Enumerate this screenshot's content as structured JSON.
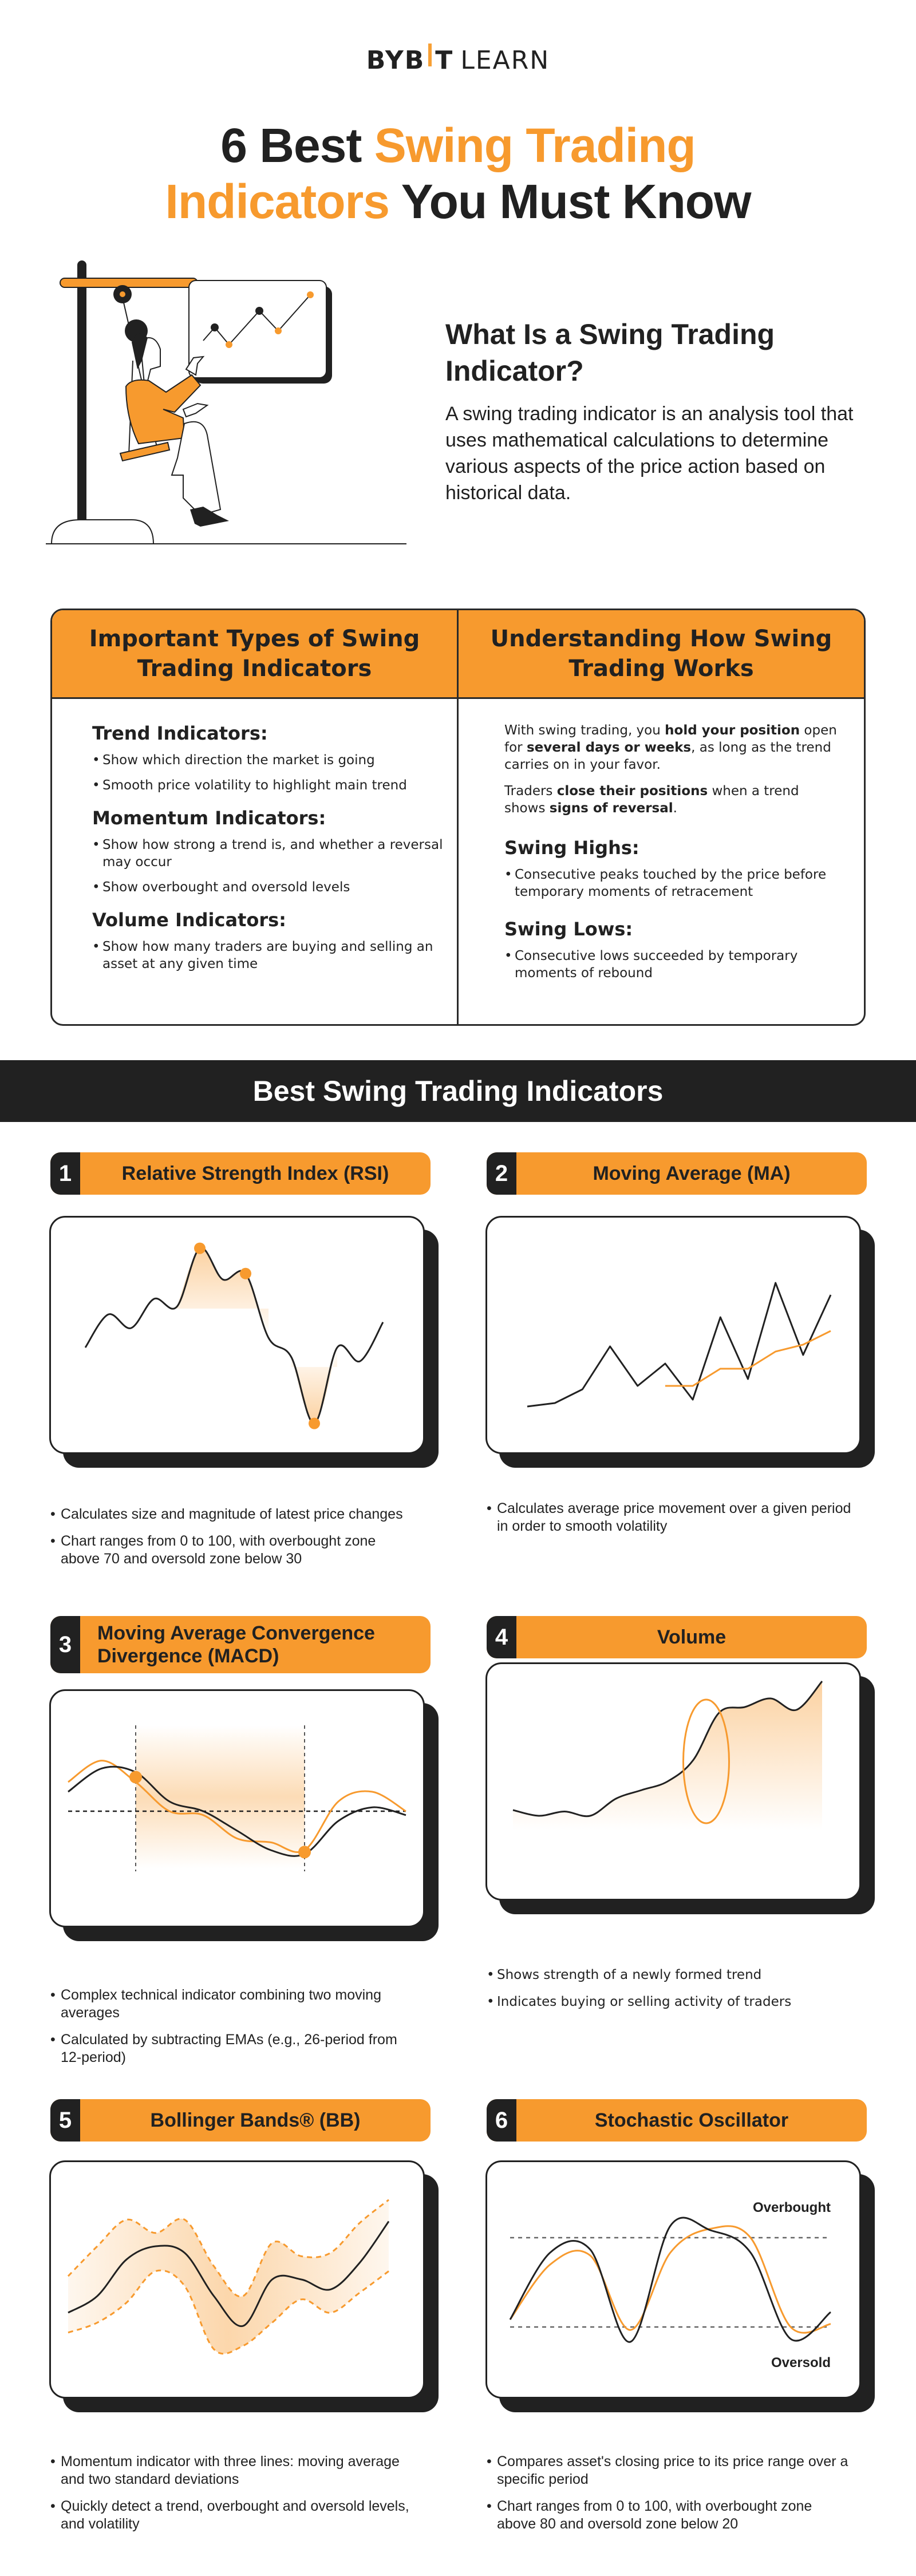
{
  "logo": {
    "brand_left": "BYB",
    "brand_right": "T",
    "product": "LEARN"
  },
  "title": {
    "line1_black": "6 Best ",
    "line1_orange": "Swing Trading",
    "line2_orange": "Indicators",
    "line2_black": " You Must Know"
  },
  "intro": {
    "heading": "What Is a Swing Trading Indicator?",
    "body": "A swing trading indicator is an analysis tool that uses mathematical calculations to determine various aspects of the price action based on historical data.",
    "illustration": "woman-on-swing-pointing-at-chart-with-plant-and-bitcoin-coins"
  },
  "types": {
    "heading": "Important Types of Swing Trading Indicators",
    "groups": [
      {
        "title": "Trend Indicators:",
        "items": [
          "Show which direction the market is going",
          "Smooth price volatility to highlight main trend"
        ]
      },
      {
        "title": "Momentum Indicators:",
        "items": [
          "Show how strong a trend is, and whether a reversal may occur",
          "Show overbought and oversold levels"
        ]
      },
      {
        "title": "Volume Indicators:",
        "items": [
          "Show how many traders are buying and selling an asset at any given time"
        ]
      }
    ]
  },
  "works": {
    "heading": "Understanding How Swing Trading Works",
    "p1": {
      "a": "With swing trading, you ",
      "b1": "hold your position",
      "c": " open for ",
      "b2": "several days or weeks",
      "d": ", as long as the trend carries on in your favor."
    },
    "p2": {
      "a": "Traders ",
      "b1": "close their positions",
      "c": " when a trend shows ",
      "b2": "signs of reversal",
      "d": "."
    },
    "groups": [
      {
        "title": "Swing Highs:",
        "items": [
          "Consecutive peaks touched by the price before temporary moments of retracement"
        ]
      },
      {
        "title": "Swing Lows:",
        "items": [
          "Consecutive lows succeeded by temporary moments of rebound"
        ]
      }
    ]
  },
  "band": {
    "title": "Best Swing Trading Indicators"
  },
  "indicators": [
    {
      "num": "1",
      "name": "Relative Strength Index (RSI)",
      "bullets": [
        "Calculates size and magnitude of latest price changes",
        "Chart ranges from 0 to 100, with overbought zone above 70 and oversold zone below 30"
      ]
    },
    {
      "num": "2",
      "name": "Moving Average (MA)",
      "bullets": [
        "Calculates average price movement over a given period in order to smooth volatility"
      ]
    },
    {
      "num": "3",
      "name": "Moving Average Convergence Divergence (MACD)",
      "bullets": [
        "Complex technical indicator combining two moving averages",
        "Calculated by subtracting EMAs (e.g., 26-period from 12-period)"
      ]
    },
    {
      "num": "4",
      "name": "Volume",
      "bullets": [
        "Shows strength of a newly formed trend",
        "Indicates buying or selling activity of traders"
      ]
    },
    {
      "num": "5",
      "name": "Bollinger Bands® (BB)",
      "bullets": [
        "Momentum indicator with three lines: moving average and two standard deviations",
        "Quickly detect a trend, overbought and oversold levels, and volatility"
      ]
    },
    {
      "num": "6",
      "name": "Stochastic Oscillator",
      "bullets": [
        "Compares asset's closing price to its price range over a specific period",
        "Chart ranges from 0 to 100, with overbought zone above 80 and oversold zone below 20"
      ],
      "labels": {
        "overbought": "Overbought",
        "oversold": "Oversold"
      }
    }
  ],
  "colors": {
    "accent": "#F79A2E",
    "dark": "#212121",
    "fill_light": "#FDE3C4"
  },
  "chart_data": [
    {
      "type": "line",
      "title": "Relative Strength Index (RSI)",
      "illustrative": true,
      "series": [
        {
          "name": "RSI",
          "values": [
            45,
            62,
            55,
            70,
            66,
            96,
            80,
            83,
            50,
            40,
            6,
            45,
            38,
            58
          ]
        }
      ],
      "markers": [
        {
          "label": "swing-high",
          "index": 5
        },
        {
          "label": "swing-high",
          "index": 7
        },
        {
          "label": "swing-low",
          "index": 10
        }
      ],
      "ylim": [
        0,
        100
      ]
    },
    {
      "type": "line",
      "title": "Moving Average (MA)",
      "illustrative": true,
      "series": [
        {
          "name": "Price",
          "values": [
            10,
            12,
            20,
            45,
            22,
            35,
            14,
            62,
            26,
            82,
            40,
            75
          ]
        },
        {
          "name": "Moving Average",
          "values": [
            null,
            null,
            null,
            null,
            null,
            22,
            22,
            32,
            32,
            42,
            46,
            54
          ]
        }
      ],
      "ylim": [
        0,
        100
      ]
    },
    {
      "type": "line",
      "title": "MACD",
      "illustrative": true,
      "series": [
        {
          "name": "MACD",
          "values": [
            60,
            72,
            70,
            55,
            50,
            40,
            30,
            28,
            45,
            52,
            48
          ]
        },
        {
          "name": "Signal",
          "values": [
            65,
            76,
            65,
            50,
            48,
            36,
            34,
            30,
            55,
            60,
            50
          ]
        }
      ],
      "zero_line": 50,
      "crossovers": [
        2,
        7
      ],
      "ylim": [
        0,
        100
      ]
    },
    {
      "type": "area",
      "title": "Volume",
      "illustrative": true,
      "series": [
        {
          "name": "Volume",
          "values": [
            10,
            6,
            9,
            6,
            18,
            24,
            30,
            45,
            78,
            82,
            88,
            80,
            100
          ]
        }
      ],
      "highlight_index_range": [
        6,
        9
      ],
      "ylim": [
        0,
        100
      ]
    },
    {
      "type": "line",
      "title": "Bollinger Bands (BB)",
      "illustrative": true,
      "series": [
        {
          "name": "Moving Average",
          "values": [
            30,
            40,
            62,
            70,
            66,
            40,
            22,
            50,
            50,
            44,
            60,
            85
          ]
        },
        {
          "name": "Upper Band",
          "values": [
            52,
            70,
            86,
            78,
            86,
            58,
            40,
            72,
            64,
            66,
            84,
            98
          ]
        },
        {
          "name": "Lower Band",
          "values": [
            18,
            24,
            36,
            55,
            46,
            8,
            10,
            24,
            38,
            30,
            42,
            55
          ]
        }
      ],
      "ylim": [
        0,
        100
      ]
    },
    {
      "type": "line",
      "title": "Stochastic Oscillator",
      "illustrative": true,
      "series": [
        {
          "name": "%K",
          "values": [
            25,
            70,
            72,
            10,
            88,
            85,
            70,
            12,
            30
          ]
        },
        {
          "name": "%D",
          "values": [
            25,
            62,
            68,
            18,
            70,
            86,
            80,
            20,
            22
          ]
        }
      ],
      "overbought": 80,
      "oversold": 20,
      "ylim": [
        0,
        100
      ]
    }
  ]
}
